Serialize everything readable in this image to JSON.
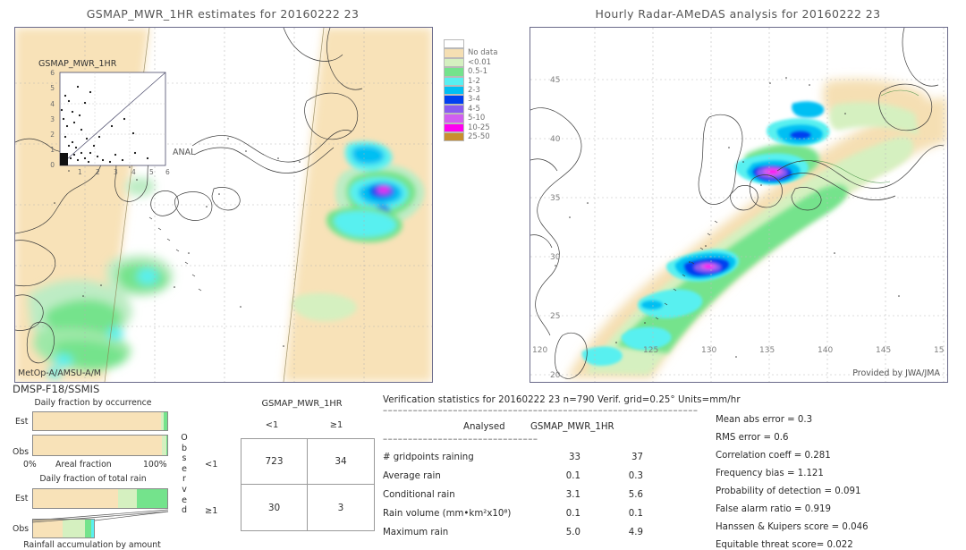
{
  "left_panel": {
    "title": "GSMAP_MWR_1HR estimates for 20160222 23",
    "corner_label": "GSMAP_MWR_1HR",
    "inset": {
      "xlabel": "ANAL",
      "ticks": [
        "0",
        "1",
        "2",
        "3",
        "4",
        "5",
        "6"
      ],
      "axis_max": 6
    },
    "footer_label": "MetOp-A/AMSU-A/M",
    "sensor_label": "DMSP-F18/SSMIS"
  },
  "right_panel": {
    "title": "Hourly Radar-AMeDAS analysis for 20160222 23",
    "credit": "Provided by JWA/JMA",
    "lon_ticks": [
      "120",
      "125",
      "130",
      "135",
      "140",
      "145",
      "15"
    ],
    "lat_ticks": [
      "45",
      "40",
      "35",
      "30",
      "25",
      "20"
    ]
  },
  "colorbar": {
    "entries": [
      {
        "label": "",
        "color": "#ffffff"
      },
      {
        "label": "No data",
        "color": "#f5dfb3"
      },
      {
        "label": "<0.01",
        "color": "#d5f0c0"
      },
      {
        "label": "0.5-1",
        "color": "#74e38c"
      },
      {
        "label": "1-2",
        "color": "#59f0f0"
      },
      {
        "label": "2-3",
        "color": "#00bff3"
      },
      {
        "label": "3-4",
        "color": "#0040f0"
      },
      {
        "label": "4-5",
        "color": "#8a5cf0"
      },
      {
        "label": "5-10",
        "color": "#d15ef0"
      },
      {
        "label": "10-25",
        "color": "#ff00f0"
      },
      {
        "label": "25-50",
        "color": "#c98f2e"
      }
    ]
  },
  "bar_charts": [
    {
      "caption": "Daily fraction by occurrence",
      "axis_left": "0%",
      "axis_center": "Areal fraction",
      "axis_right": "100%",
      "rows": [
        {
          "label": "Est",
          "segments": [
            {
              "color": "#f8e2b8",
              "pct": 95.5
            },
            {
              "color": "#d5f0c0",
              "pct": 1.5
            },
            {
              "color": "#74e38c",
              "pct": 3.0
            }
          ]
        },
        {
          "label": "Obs",
          "segments": [
            {
              "color": "#f8e2b8",
              "pct": 96.0
            },
            {
              "color": "#d5f0c0",
              "pct": 3.3
            },
            {
              "color": "#74e38c",
              "pct": 0.7
            }
          ]
        }
      ]
    },
    {
      "caption": "Daily fraction of total rain",
      "axis_bottom": "Rainfall accumulation by amount",
      "rows": [
        {
          "label": "Est",
          "width_pct": 100,
          "segments": [
            {
              "color": "#f8e2b8",
              "pct": 63.0
            },
            {
              "color": "#d5f0c0",
              "pct": 14.0
            },
            {
              "color": "#74e38c",
              "pct": 23.0
            }
          ]
        },
        {
          "label": "Obs",
          "width_pct": 46,
          "segments": [
            {
              "color": "#f8e2b8",
              "pct": 48.0
            },
            {
              "color": "#d5f0c0",
              "pct": 38.0
            },
            {
              "color": "#74e38c",
              "pct": 10.0
            },
            {
              "color": "#59f0f0",
              "pct": 4.0
            }
          ]
        }
      ]
    }
  ],
  "contingency": {
    "title": "GSMAP_MWR_1HR",
    "col_headers": [
      "<1",
      "≥1"
    ],
    "row_headers": [
      "<1",
      "≥1"
    ],
    "axis_label": "Observed",
    "cells": [
      [
        "723",
        "34"
      ],
      [
        "30",
        "3"
      ]
    ]
  },
  "stats": {
    "header": "Verification statistics for 20160222 23  n=790  Verif. grid=0.25°  Units=mm/hr",
    "col_headers": [
      "Analysed",
      "GSMAP_MWR_1HR"
    ],
    "rows": [
      {
        "name": "# gridpoints raining",
        "analysed": "33",
        "estimate": "37"
      },
      {
        "name": "Average rain",
        "analysed": "0.1",
        "estimate": "0.3"
      },
      {
        "name": "Conditional rain",
        "analysed": "3.1",
        "estimate": "5.6"
      },
      {
        "name": "Rain volume (mm•km²x10⁸)",
        "analysed": "0.1",
        "estimate": "0.1"
      },
      {
        "name": "Maximum rain",
        "analysed": "5.0",
        "estimate": "4.9"
      }
    ],
    "scores": [
      "Mean abs error = 0.3",
      "RMS error = 0.6",
      "Correlation coeff = 0.281",
      "Frequency bias = 1.121",
      "Probability of detection = 0.091",
      "False alarm ratio = 0.919",
      "Hanssen & Kuipers score = 0.046",
      "Equitable threat score= 0.022"
    ]
  }
}
